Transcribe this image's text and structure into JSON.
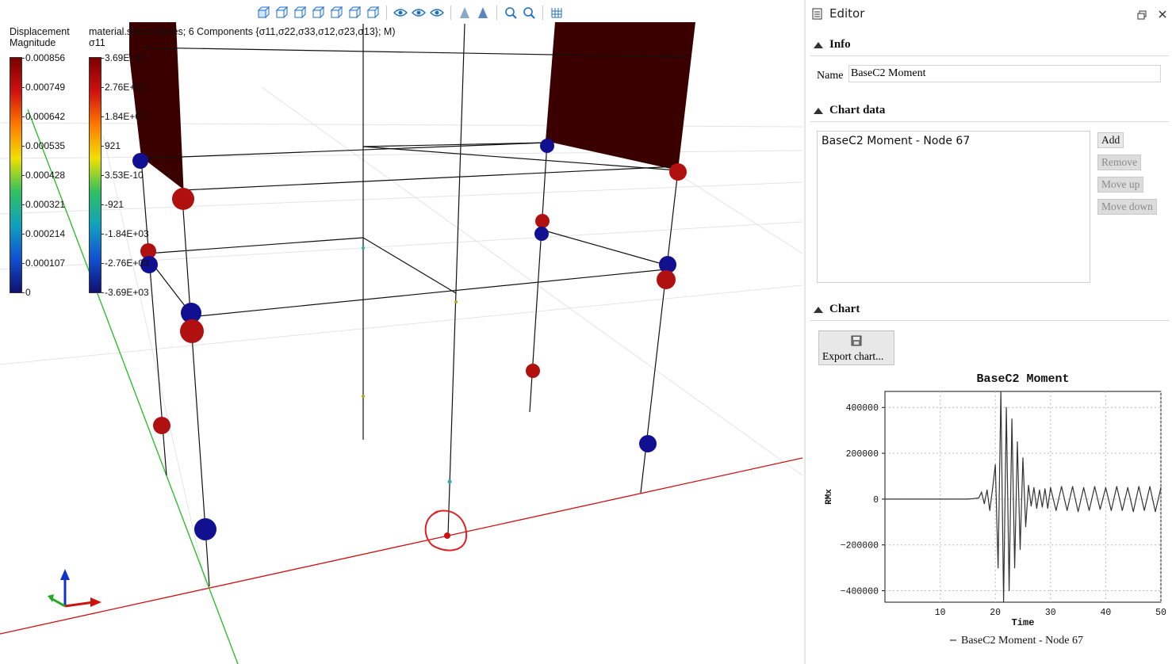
{
  "viewport": {
    "toolbar_icons": [
      "iso-view-icon",
      "front-view-icon",
      "back-view-icon",
      "top-view-icon",
      "bottom-view-icon",
      "left-view-icon",
      "right-view-icon",
      "visibility-icon",
      "show-icon",
      "hide-icon",
      "perspective-icon",
      "parallel-icon",
      "zoom-fit-icon",
      "zoom-icon",
      "grid-icon"
    ],
    "displacement_legend": {
      "title_line1": "Displacement",
      "title_line2": "Magnitude",
      "labels": [
        "0.000856",
        "0.000749",
        "0.000642",
        "0.000535",
        "0.000428",
        "0.000321",
        "0.000214",
        "0.000107",
        "0"
      ]
    },
    "stress_legend": {
      "title_line1": "material.stress (times; 6 Components {σ11,σ22,σ33,σ12,σ23,σ13}; M)",
      "title_line2": "σ11",
      "labels": [
        "3.69E+03",
        "2.76E+03",
        "1.84E+03",
        "921",
        "3.53E-10",
        "-921",
        "-1.84E+03",
        "-2.76E+03",
        "-3.69E+03"
      ]
    },
    "colors": {
      "red_node": "#b01010",
      "blue_node": "#101090",
      "wall": "#3a0000",
      "x_axis": "#cc1111",
      "y_axis": "#22bb22"
    }
  },
  "editor": {
    "title": "Editor",
    "info": {
      "header": "Info",
      "name_label": "Name",
      "name_value": "BaseC2 Moment"
    },
    "chart_data_section": {
      "header": "Chart data",
      "items": [
        "BaseC2 Moment - Node 67"
      ],
      "buttons": {
        "add": "Add",
        "remove": "Remove",
        "move_up": "Move up",
        "move_down": "Move down"
      }
    },
    "chart_section": {
      "header": "Chart",
      "export_label": "Export chart..."
    }
  },
  "chart_data": {
    "type": "line",
    "title": "BaseC2 Moment",
    "xlabel": "Time",
    "ylabel": "RMx",
    "xlim": [
      0,
      50
    ],
    "ylim": [
      -450000,
      470000
    ],
    "xticks": [
      10,
      20,
      30,
      40,
      50
    ],
    "yticks": [
      -400000,
      -200000,
      0,
      200000,
      400000
    ],
    "grid": true,
    "legend_position": "bottom",
    "series": [
      {
        "name": "BaseC2 Moment - Node 67",
        "x": [
          0,
          10,
          15,
          16,
          17,
          17.5,
          18,
          18.5,
          19,
          19.5,
          20,
          20.5,
          21,
          21.5,
          22,
          22.5,
          23,
          23.5,
          24,
          24.5,
          25,
          25.5,
          26,
          26.5,
          27,
          27.5,
          28,
          28.5,
          29,
          29.5,
          30,
          31,
          32,
          33,
          34,
          35,
          36,
          37,
          38,
          39,
          40,
          41,
          42,
          43,
          44,
          45,
          46,
          47,
          48,
          49,
          50
        ],
        "values": [
          0,
          0,
          0,
          2000,
          5000,
          30000,
          -20000,
          40000,
          -50000,
          45000,
          150000,
          -300000,
          470000,
          -450000,
          400000,
          -400000,
          350000,
          -300000,
          250000,
          -220000,
          180000,
          -120000,
          60000,
          -30000,
          50000,
          -40000,
          40000,
          -35000,
          45000,
          -40000,
          50000,
          -50000,
          55000,
          -50000,
          55000,
          -55000,
          50000,
          -50000,
          55000,
          -45000,
          50000,
          -50000,
          55000,
          -50000,
          50000,
          -55000,
          55000,
          -50000,
          55000,
          -55000,
          50000
        ]
      }
    ]
  }
}
